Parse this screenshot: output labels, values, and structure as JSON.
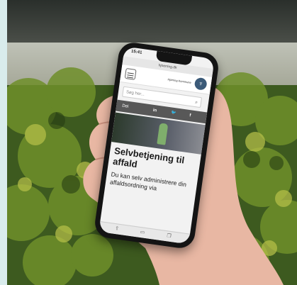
{
  "phone": {
    "status_time": "15:41",
    "url": "hjoerring.dk",
    "org_name": "Hjørring Kommune",
    "search_placeholder": "Søg her...",
    "share_label": "Del",
    "share_icons": [
      "in",
      "twitter-icon",
      "f"
    ],
    "headline": "Selvbetjening til affald",
    "body_text": "Du kan selv administrere din affaldsordning via",
    "colors": {
      "share_bar": "#585858",
      "logo": "#3b5a78"
    }
  }
}
